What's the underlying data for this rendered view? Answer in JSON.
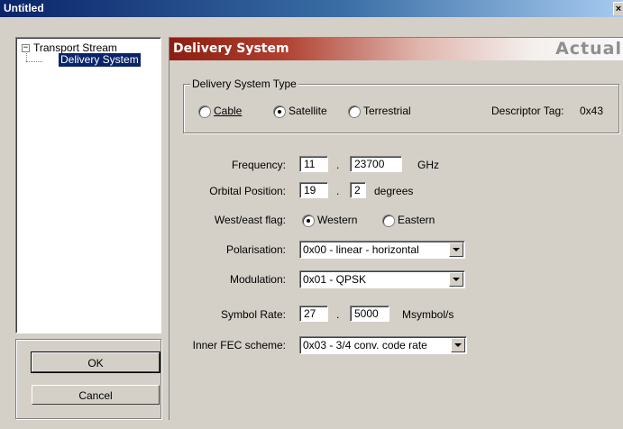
{
  "window": {
    "title": "Untitled",
    "close_glyph": "×"
  },
  "tree": {
    "root_label": "Transport Stream",
    "expander_glyph": "−",
    "child_label": "Delivery System"
  },
  "buttons": {
    "ok_label": "OK",
    "cancel_label": "Cancel"
  },
  "header": {
    "title": "Delivery System",
    "right_label": "Actual"
  },
  "delivery_type": {
    "group_label": "Delivery System Type",
    "options": [
      {
        "label": "Cable",
        "selected": false
      },
      {
        "label": "Satellite",
        "selected": true
      },
      {
        "label": "Terrestrial",
        "selected": false
      }
    ],
    "descriptor_tag_label": "Descriptor Tag:",
    "descriptor_tag_value": "0x43"
  },
  "frequency": {
    "label": "Frequency:",
    "integer": "11",
    "separator": ".",
    "fraction": "23700",
    "unit": "GHz"
  },
  "orbital_position": {
    "label": "Orbital Position:",
    "integer": "19",
    "separator": ".",
    "fraction": "2",
    "unit": "degrees"
  },
  "west_east_flag": {
    "label": "West/east flag:",
    "options": [
      {
        "label": "Western",
        "selected": true
      },
      {
        "label": "Eastern",
        "selected": false
      }
    ]
  },
  "polarisation": {
    "label": "Polarisation:",
    "value": "0x00 - linear - horizontal"
  },
  "modulation": {
    "label": "Modulation:",
    "value": "0x01 - QPSK"
  },
  "symbol_rate": {
    "label": "Symbol Rate:",
    "integer": "27",
    "separator": ".",
    "fraction": "5000",
    "unit": "Msymbol/s"
  },
  "inner_fec": {
    "label": "Inner FEC scheme:",
    "value": "0x03 - 3/4 conv. code rate"
  },
  "colors": {
    "header_red": "#8b1e12",
    "titlebar_blue": "#0a246a",
    "face": "#d4d0c8"
  }
}
